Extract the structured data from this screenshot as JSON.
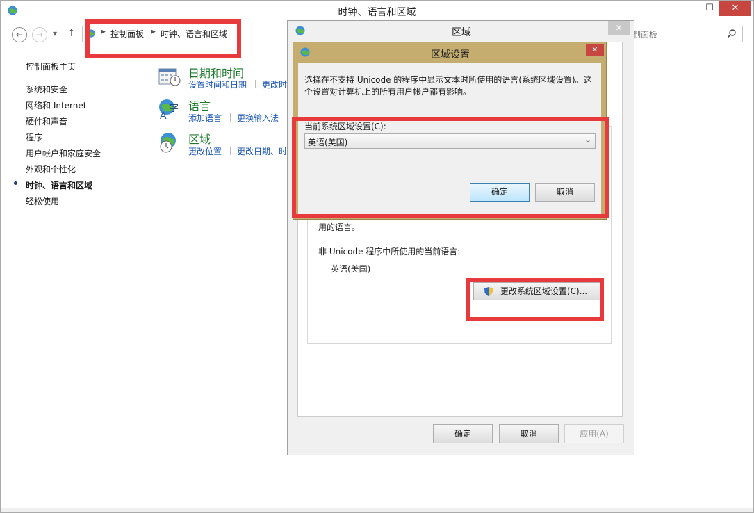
{
  "main_window": {
    "title": "时钟、语言和区域",
    "minimize": "—",
    "maximize": "☐",
    "close": "✕"
  },
  "nav": {
    "back": "←",
    "forward": "→",
    "dropdown": "▾",
    "up": "↑",
    "breadcrumb": [
      "控制面板",
      "时钟、语言和区域"
    ],
    "search_placeholder": "制面板"
  },
  "sidebar": {
    "home": "控制面板主页",
    "items": [
      "系统和安全",
      "网络和 Internet",
      "硬件和声音",
      "程序",
      "用户帐户和家庭安全",
      "外观和个性化",
      "时钟、语言和区域",
      "轻松使用"
    ],
    "current_index": 6
  },
  "categories": [
    {
      "title": "日期和时间",
      "links": [
        "设置时间和日期",
        "更改时"
      ],
      "icon": "calendar-clock-icon"
    },
    {
      "title": "语言",
      "links": [
        "添加语言",
        "更换输入法"
      ],
      "icon": "language-icon"
    },
    {
      "title": "区域",
      "links": [
        "更改位置",
        "更改日期、时"
      ],
      "icon": "globe-clock-icon"
    }
  ],
  "region_dialog": {
    "title": "区域",
    "close": "✕",
    "text_fragment": "用的语言。",
    "nonunicode_label": "非 Unicode 程序中所使用的当前语言:",
    "current_lang": "英语(美国)",
    "change_button": "更改系统区域设置(C)...",
    "ok": "确定",
    "cancel": "取消",
    "apply": "应用(A)"
  },
  "locale_dialog": {
    "title": "区域设置",
    "close": "✕",
    "description": "选择在不支持 Unicode 的程序中显示文本时所使用的语言(系统区域设置)。这个设置对计算机上的所有用户帐户都有影响。",
    "current_label": "当前系统区域设置(C):",
    "selected": "英语(美国)",
    "ok": "确定",
    "cancel": "取消"
  },
  "colors": {
    "highlight": "#e8393c",
    "locale_dialog_frame": "#c4ad6f",
    "category_title": "#1e7b2e",
    "link": "#1a56b3"
  }
}
